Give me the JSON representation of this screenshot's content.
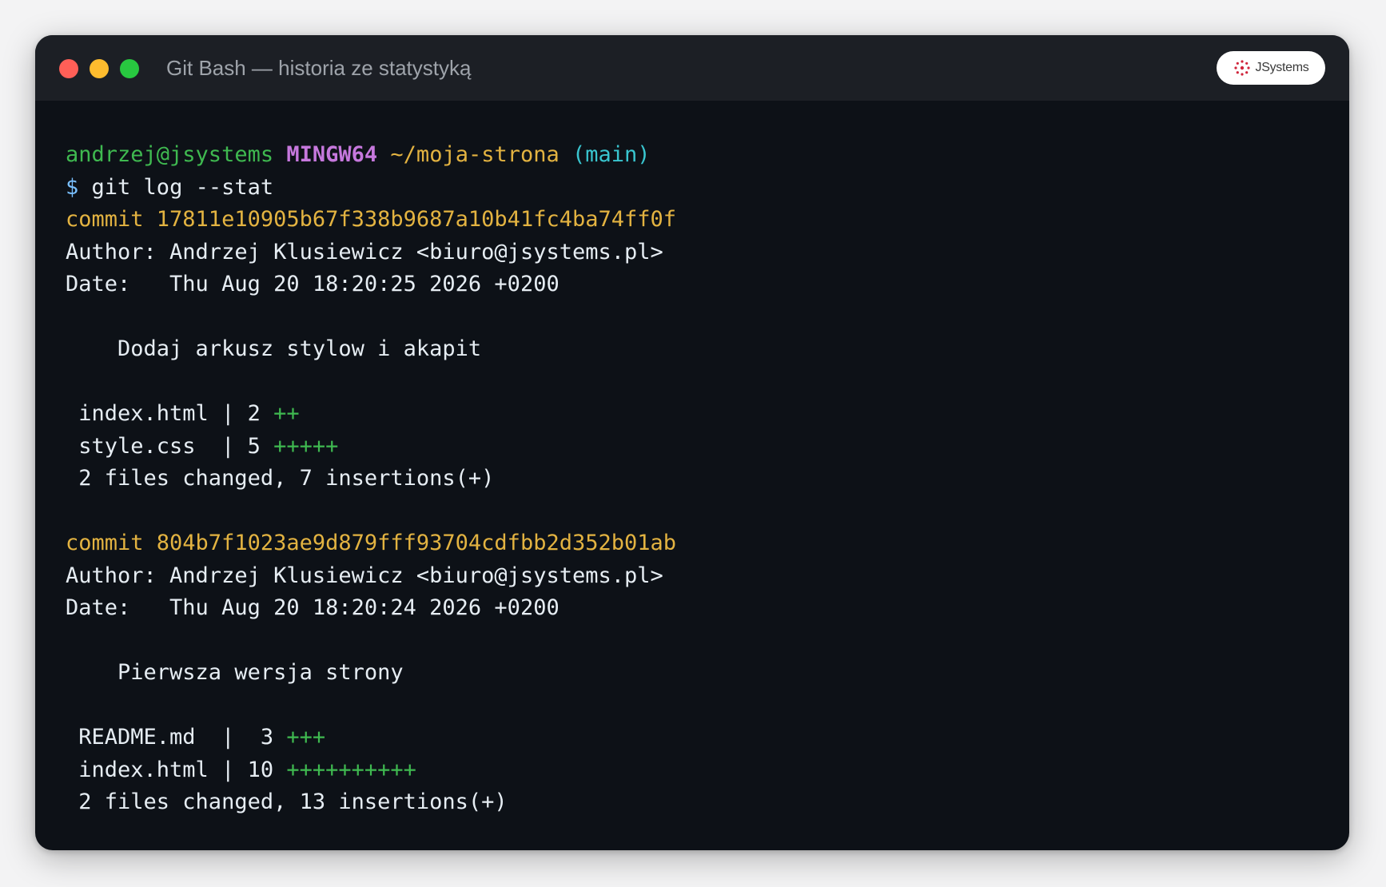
{
  "window": {
    "title": "Git Bash — historia ze statystyką",
    "logo_text": "JSystems"
  },
  "prompt": {
    "user_host": "andrzej@jsystems",
    "system": "MINGW64",
    "path": "~/moja-strona",
    "branch": "(main)",
    "dollar": "$",
    "command": "git log --stat"
  },
  "commits": [
    {
      "commit_line": "commit 17811e10905b67f338b9687a10b41fc4ba74ff0f",
      "author_line": "Author: Andrzej Klusiewicz <biuro@jsystems.pl>",
      "date_line": "Date:   Thu Aug 20 18:20:25 2026 +0200",
      "message": "    Dodaj arkusz stylow i akapit",
      "files": [
        {
          "left": " index.html | 2 ",
          "plus": "++"
        },
        {
          "left": " style.css  | 5 ",
          "plus": "+++++"
        }
      ],
      "summary": " 2 files changed, 7 insertions(+)"
    },
    {
      "commit_line": "commit 804b7f1023ae9d879fff93704cdfbb2d352b01ab",
      "author_line": "Author: Andrzej Klusiewicz <biuro@jsystems.pl>",
      "date_line": "Date:   Thu Aug 20 18:20:24 2026 +0200",
      "message": "    Pierwsza wersja strony",
      "files": [
        {
          "left": " README.md  |  3 ",
          "plus": "+++"
        },
        {
          "left": " index.html | 10 ",
          "plus": "++++++++++"
        }
      ],
      "summary": " 2 files changed, 13 insertions(+)"
    }
  ],
  "colors": {
    "background": "#0d1117",
    "user": "#3fb950",
    "host": "#c678dd",
    "path": "#e3b341",
    "branch": "#39c5cf",
    "commit_hash": "#e3b341",
    "insertions": "#3fb950"
  }
}
